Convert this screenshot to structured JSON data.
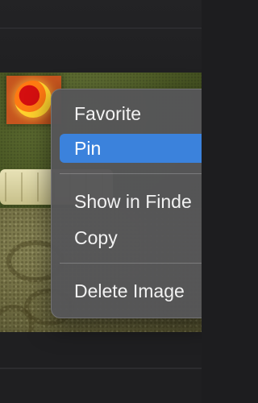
{
  "context_menu": {
    "items": [
      {
        "label": "Favorite",
        "highlighted": false
      },
      {
        "label": "Pin",
        "highlighted": true
      },
      {
        "label": "Show in Finde",
        "highlighted": false
      },
      {
        "label": "Copy",
        "highlighted": false
      },
      {
        "label": "Delete Image",
        "highlighted": false
      }
    ]
  },
  "colors": {
    "highlight": "#3b82dc",
    "menu_background": "#565658",
    "window_background": "#1e1e20"
  }
}
